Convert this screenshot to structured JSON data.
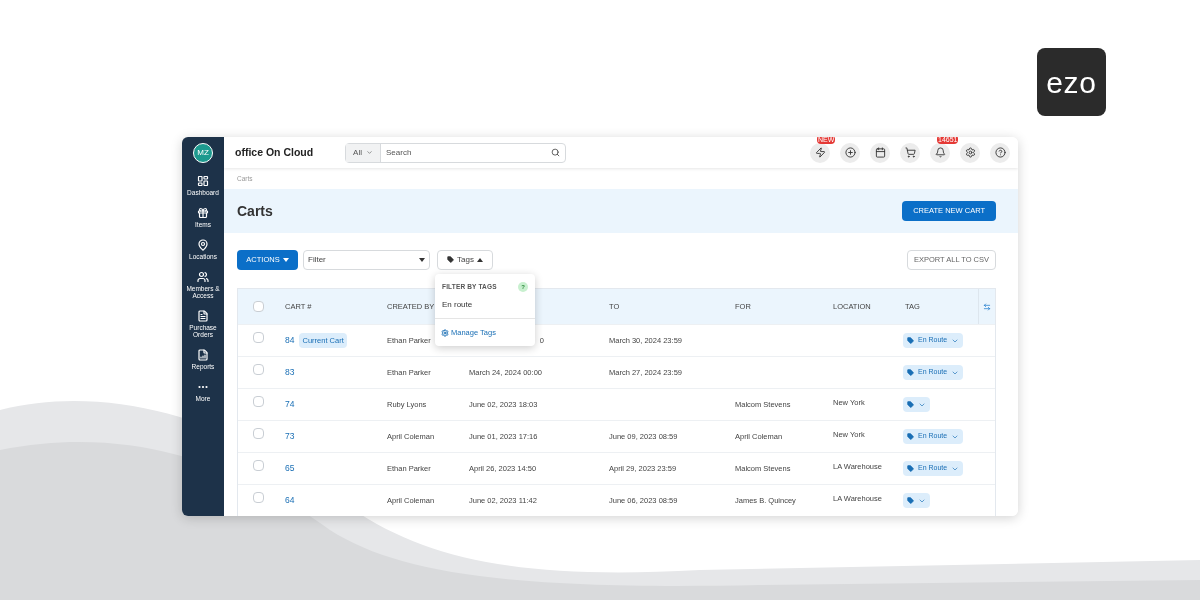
{
  "brand": {
    "logo": "ezo"
  },
  "app": {
    "avatar": "MZ",
    "title": "office On Cloud",
    "search": {
      "scope": "All",
      "placeholder": "Search"
    },
    "top_icons": [
      {
        "kind": "bolt",
        "badge": "NEW"
      },
      {
        "kind": "plus"
      },
      {
        "kind": "calendar"
      },
      {
        "kind": "cart"
      },
      {
        "kind": "bell",
        "badge": "14651"
      },
      {
        "kind": "gear"
      },
      {
        "kind": "help"
      }
    ]
  },
  "sidebar": {
    "items": [
      {
        "kind": "dashboard",
        "label": "Dashboard"
      },
      {
        "kind": "items",
        "label": "Items"
      },
      {
        "kind": "locations",
        "label": "Locations"
      },
      {
        "kind": "members",
        "label": "Members & Access"
      },
      {
        "kind": "purchase",
        "label": "Purchase Orders"
      },
      {
        "kind": "reports",
        "label": "Reports"
      },
      {
        "kind": "more",
        "label": "More"
      }
    ]
  },
  "breadcrumb": "Carts",
  "page_title": "Carts",
  "create_button": "CREATE NEW CART",
  "toolbar": {
    "actions": "ACTIONS",
    "filter": "Filter",
    "tags": "Tags",
    "export": "EXPORT ALL TO CSV"
  },
  "tags_menu": {
    "title": "FILTER BY TAGS",
    "help": "?",
    "options": [
      "En route"
    ],
    "manage": "Manage Tags"
  },
  "table": {
    "select_all": {
      "checked": false
    },
    "columns": [
      "CART #",
      "CREATED BY",
      "",
      "TO",
      "FOR",
      "LOCATION",
      "TAG"
    ],
    "rows": [
      {
        "checked": false,
        "cart": "84",
        "badge": "Current Cart",
        "created_by": "Ethan Parker",
        "from": "0",
        "from_partial": true,
        "to": "March 30, 2024 23:59",
        "for": "",
        "location": "",
        "tag": "En Route"
      },
      {
        "checked": false,
        "cart": "83",
        "created_by": "Ethan Parker",
        "from": "March 24, 2024 00:00",
        "from_partial": false,
        "to": "March 27, 2024 23:59",
        "for": "",
        "location": "",
        "tag": "En Route"
      },
      {
        "checked": false,
        "cart": "74",
        "created_by": "Ruby Lyons",
        "from": "June 02, 2023 18:03",
        "from_partial": false,
        "to": "",
        "for": "Malcom Stevens",
        "location": "New York",
        "tag": ""
      },
      {
        "checked": false,
        "cart": "73",
        "created_by": "April Coleman",
        "from": "June 01, 2023 17:16",
        "from_partial": false,
        "to": "June 09, 2023 08:59",
        "for": "April Coleman",
        "location": "New York",
        "tag": "En Route"
      },
      {
        "checked": false,
        "cart": "65",
        "created_by": "Ethan Parker",
        "from": "April 26, 2023 14:50",
        "from_partial": false,
        "to": "April 29, 2023 23:59",
        "for": "Malcom Stevens",
        "location": "LA Warehouse",
        "tag": "En Route"
      },
      {
        "checked": false,
        "cart": "64",
        "created_by": "April Coleman",
        "from": "June 02, 2023 11:42",
        "from_partial": false,
        "to": "June 06, 2023 08:59",
        "for": "James B. Quincey",
        "location": "LA Warehouse",
        "tag": ""
      }
    ]
  }
}
